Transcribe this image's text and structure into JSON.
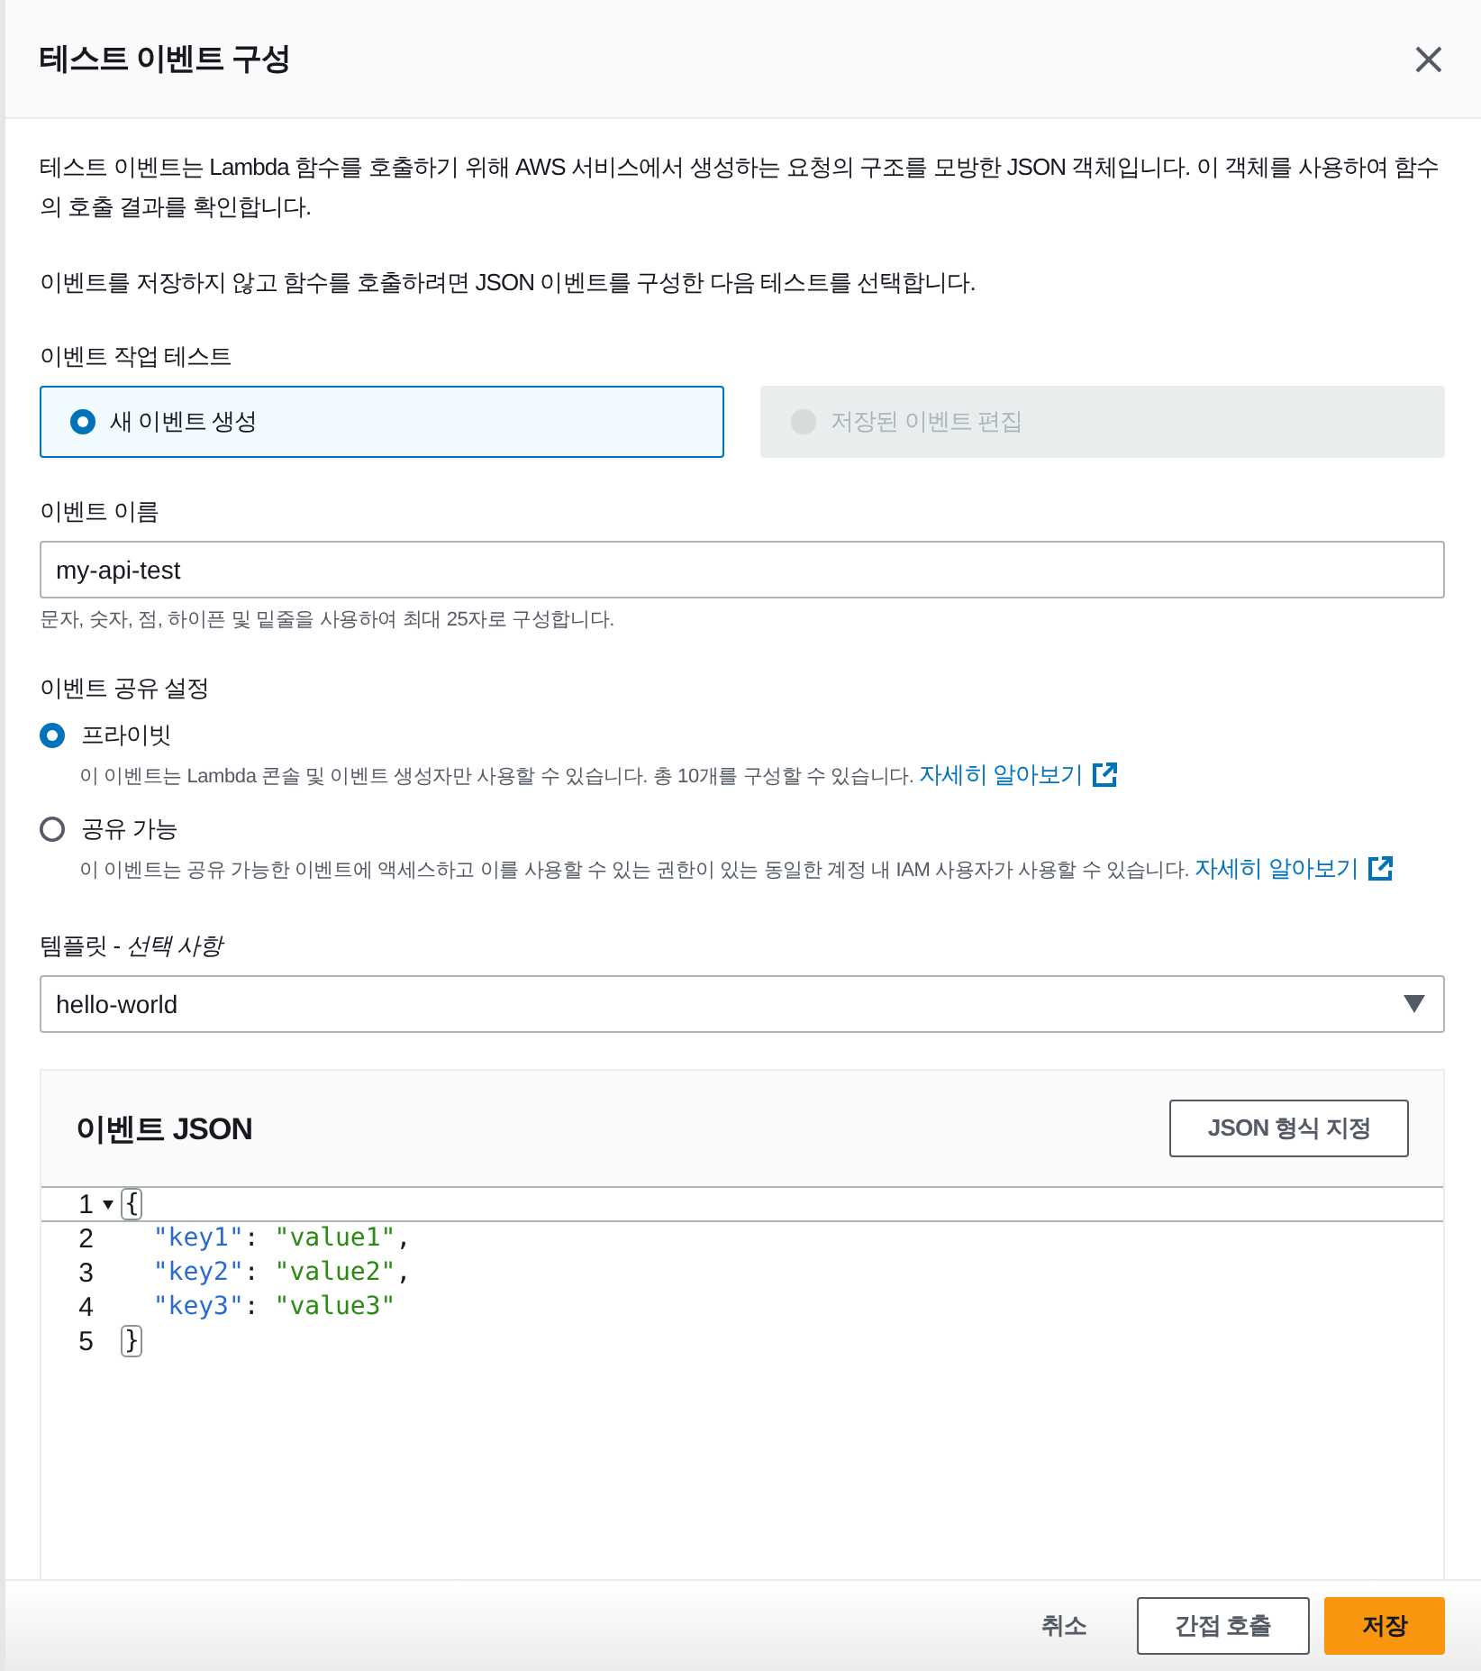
{
  "dialog": {
    "title": "테스트 이벤트 구성"
  },
  "intro": [
    "테스트 이벤트는 Lambda 함수를 호출하기 위해 AWS 서비스에서 생성하는 요청의 구조를 모방한 JSON 객체입니다. 이 객체를 사용하여 함수의 호출 결과를 확인합니다.",
    "이벤트를 저장하지 않고 함수를 호출하려면 JSON 이벤트를 구성한 다음 테스트를 선택합니다."
  ],
  "event_action": {
    "label": "이벤트 작업 테스트",
    "options": [
      {
        "label": "새 이벤트 생성",
        "selected": true,
        "disabled": false
      },
      {
        "label": "저장된 이벤트 편집",
        "selected": false,
        "disabled": true
      }
    ]
  },
  "event_name": {
    "label": "이벤트 이름",
    "value": "my-api-test",
    "hint": "문자, 숫자, 점, 하이픈 및 밑줄을 사용하여 최대 25자로 구성합니다."
  },
  "sharing": {
    "label": "이벤트 공유 설정",
    "options": [
      {
        "label": "프라이빗",
        "selected": true,
        "description": "이 이벤트는 Lambda 콘솔 및 이벤트 생성자만 사용할 수 있습니다. 총 10개를 구성할 수 있습니다.",
        "link": "자세히 알아보기"
      },
      {
        "label": "공유 가능",
        "selected": false,
        "description": "이 이벤트는 공유 가능한 이벤트에 액세스하고 이를 사용할 수 있는 권한이 있는 동일한 계정 내 IAM 사용자가 사용할 수 있습니다.",
        "link": "자세히 알아보기"
      }
    ]
  },
  "template": {
    "label": "템플릿 - *선택 사항*",
    "value": "hello-world"
  },
  "event_json": {
    "title": "이벤트 JSON",
    "format_button": "JSON 형식 지정",
    "lines": [
      {
        "number": "1",
        "active": true,
        "foldable": true,
        "tokens": [
          {
            "kind": "open",
            "text": "{"
          }
        ]
      },
      {
        "number": "2",
        "active": false,
        "foldable": false,
        "tokens": [
          {
            "kind": "key",
            "text": "\"key1\""
          },
          {
            "kind": "colon",
            "text": ":"
          },
          {
            "kind": "string",
            "text": "\"value1\""
          },
          {
            "kind": "comma",
            "text": ","
          }
        ]
      },
      {
        "number": "3",
        "active": false,
        "foldable": false,
        "tokens": [
          {
            "kind": "key",
            "text": "\"key2\""
          },
          {
            "kind": "colon",
            "text": ":"
          },
          {
            "kind": "string",
            "text": "\"value2\""
          },
          {
            "kind": "comma",
            "text": ","
          }
        ]
      },
      {
        "number": "4",
        "active": false,
        "foldable": false,
        "tokens": [
          {
            "kind": "key",
            "text": "\"key3\""
          },
          {
            "kind": "colon",
            "text": ":"
          },
          {
            "kind": "string",
            "text": "\"value3\""
          }
        ]
      },
      {
        "number": "5",
        "active": false,
        "foldable": false,
        "tokens": [
          {
            "kind": "close",
            "text": "}"
          }
        ]
      }
    ]
  },
  "footer": {
    "buttons": [
      {
        "kind": "link",
        "label": "취소"
      },
      {
        "kind": "normal",
        "label": "간접 호출"
      },
      {
        "kind": "primary",
        "label": "저장"
      }
    ]
  }
}
